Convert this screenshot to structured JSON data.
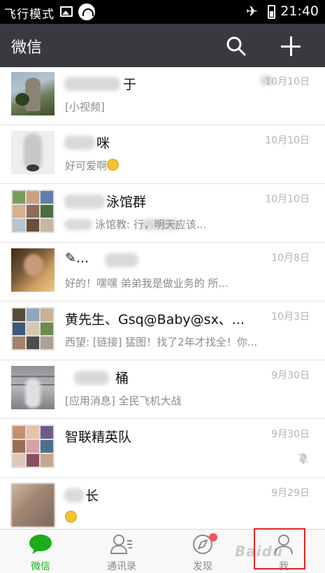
{
  "status_bar": {
    "mode_label": "飞行模式",
    "time": "21:40",
    "icons": [
      "image-icon",
      "wifi-icon",
      "airplane-icon",
      "battery-icon"
    ]
  },
  "header": {
    "title": "微信",
    "icons": [
      "search-icon",
      "plus-icon"
    ]
  },
  "chats": [
    {
      "name": "于",
      "preview": "[小视频]",
      "time": "10月10日",
      "muted": false
    },
    {
      "name": "咪",
      "preview": "好可爱啊",
      "time": "10月10日",
      "muted": false
    },
    {
      "name": "泳馆群",
      "preview": "泳馆教: 行，明天应该...",
      "time": "10月10日",
      "muted": false
    },
    {
      "name": "✎...",
      "preview": "好的！嘿嘿 弟弟我是做业务的 所...",
      "time": "10月8日",
      "muted": false
    },
    {
      "name": "黄先生、Gsq@Baby@sx、...",
      "preview": "西望: [链接] 猛图！找了2年才找全！你...",
      "time": "10月3日",
      "muted": false
    },
    {
      "name": "桶",
      "preview": "[应用消息] 全民飞机大战",
      "time": "9月30日",
      "muted": false
    },
    {
      "name": "智联精英队",
      "preview": "",
      "time": "9月30日",
      "muted": true
    },
    {
      "name": "长",
      "preview": "",
      "time": "9月29日",
      "muted": false
    }
  ],
  "tabs": [
    {
      "label": "微信",
      "icon": "chat-bubble-icon",
      "active": true
    },
    {
      "label": "通讯录",
      "icon": "contacts-icon",
      "active": false
    },
    {
      "label": "发现",
      "icon": "compass-icon",
      "active": false,
      "badge": true
    },
    {
      "label": "我",
      "icon": "person-icon",
      "active": false
    }
  ],
  "colors": {
    "header_bg": "#393a3f",
    "accent_green": "#1aad19",
    "badge_red": "#fa5151",
    "highlight_red": "#e02424"
  },
  "watermark": "Baidu"
}
